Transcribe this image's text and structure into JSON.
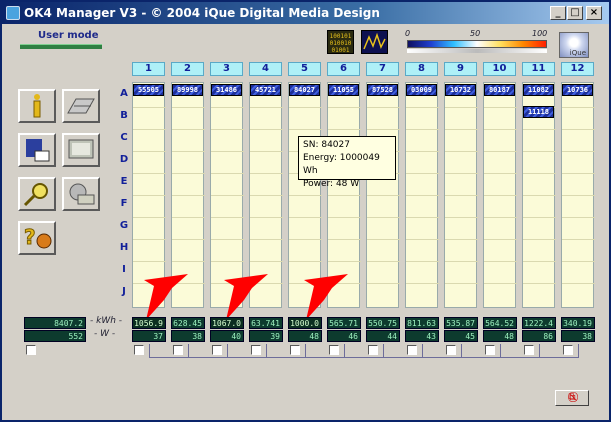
{
  "window": {
    "title": "OK4 Manager V3 - © 2004 iQue Digital Media Design",
    "buttons": [
      "_",
      "□",
      "×"
    ]
  },
  "header": {
    "user_mode": "User mode",
    "binary_icon_text": [
      "100101",
      "010010",
      "01001"
    ],
    "scale_labels": [
      "0",
      "50",
      "100"
    ],
    "logo_text": "iQue"
  },
  "columns": [
    "1",
    "2",
    "3",
    "4",
    "5",
    "6",
    "7",
    "8",
    "9",
    "10",
    "11",
    "12"
  ],
  "rows": [
    "A",
    "B",
    "C",
    "D",
    "E",
    "F",
    "G",
    "H",
    "I",
    "J"
  ],
  "badges": [
    {
      "col": 0,
      "row": 0,
      "text": "55505"
    },
    {
      "col": 1,
      "row": 0,
      "text": "89998"
    },
    {
      "col": 2,
      "row": 0,
      "text": "31486"
    },
    {
      "col": 3,
      "row": 0,
      "text": "45721"
    },
    {
      "col": 4,
      "row": 0,
      "text": "84027"
    },
    {
      "col": 5,
      "row": 0,
      "text": "11055"
    },
    {
      "col": 6,
      "row": 0,
      "text": "87528"
    },
    {
      "col": 7,
      "row": 0,
      "text": "03009"
    },
    {
      "col": 8,
      "row": 0,
      "text": "10732"
    },
    {
      "col": 9,
      "row": 0,
      "text": "80187"
    },
    {
      "col": 10,
      "row": 0,
      "text": "11082"
    },
    {
      "col": 11,
      "row": 0,
      "text": "10736"
    },
    {
      "col": 10,
      "row": 1,
      "text": "11118"
    }
  ],
  "tooltip": {
    "sn": "SN: 84027",
    "energy": "Energy: 1000049 Wh",
    "power": "Power: 48 W"
  },
  "totals": {
    "kwh": "8407.2",
    "w": "552"
  },
  "units": {
    "kwh": "- kWh -",
    "w": "- W -"
  },
  "kwh": [
    "1056.9",
    "628.45",
    "1067.0",
    "63.741",
    "1000.0",
    "565.71",
    "550.75",
    "811.63",
    "535.87",
    "564.52",
    "1222.4",
    "340.19"
  ],
  "w": [
    "37",
    "38",
    "40",
    "39",
    "48",
    "46",
    "44",
    "43",
    "45",
    "48",
    "86",
    "38"
  ],
  "colors": {
    "accent": "#0a246a",
    "arrow": "#ff0000",
    "cell": "#fbfbd8",
    "header": "#aef0f7"
  },
  "icons": {
    "toolbar": [
      "info-icon",
      "panel-grid-icon",
      "log-disk-icon",
      "monitor-panel-icon",
      "search-key-icon",
      "panel-settings-icon",
      "help-icon"
    ],
    "corner": "restore-close-icon"
  }
}
